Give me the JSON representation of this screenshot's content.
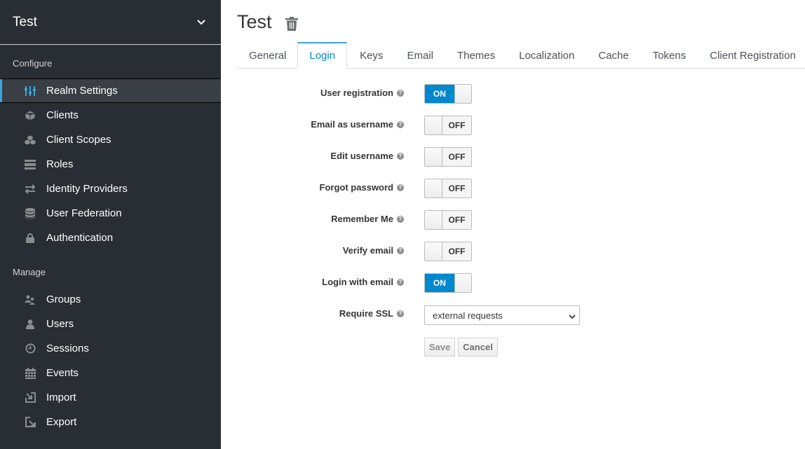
{
  "sidebar": {
    "realm_name": "Test",
    "configure_label": "Configure",
    "manage_label": "Manage",
    "configure_items": [
      {
        "label": "Realm Settings",
        "icon": "sliders-icon",
        "active": true
      },
      {
        "label": "Clients",
        "icon": "cube-icon"
      },
      {
        "label": "Client Scopes",
        "icon": "cubes-icon"
      },
      {
        "label": "Roles",
        "icon": "list-icon"
      },
      {
        "label": "Identity Providers",
        "icon": "exchange-icon"
      },
      {
        "label": "User Federation",
        "icon": "database-icon"
      },
      {
        "label": "Authentication",
        "icon": "lock-icon"
      }
    ],
    "manage_items": [
      {
        "label": "Groups",
        "icon": "users-icon"
      },
      {
        "label": "Users",
        "icon": "user-icon"
      },
      {
        "label": "Sessions",
        "icon": "clock-icon"
      },
      {
        "label": "Events",
        "icon": "calendar-icon"
      },
      {
        "label": "Import",
        "icon": "import-icon"
      },
      {
        "label": "Export",
        "icon": "export-icon"
      }
    ]
  },
  "header": {
    "title": "Test",
    "delete_icon": "trash-icon"
  },
  "tabs": [
    {
      "label": "General"
    },
    {
      "label": "Login",
      "active": true
    },
    {
      "label": "Keys"
    },
    {
      "label": "Email"
    },
    {
      "label": "Themes"
    },
    {
      "label": "Localization"
    },
    {
      "label": "Cache"
    },
    {
      "label": "Tokens"
    },
    {
      "label": "Client Registration"
    }
  ],
  "form": {
    "fields": [
      {
        "label": "User registration",
        "type": "toggle",
        "value": "ON"
      },
      {
        "label": "Email as username",
        "type": "toggle",
        "value": "OFF"
      },
      {
        "label": "Edit username",
        "type": "toggle",
        "value": "OFF"
      },
      {
        "label": "Forgot password",
        "type": "toggle",
        "value": "OFF"
      },
      {
        "label": "Remember Me",
        "type": "toggle",
        "value": "OFF"
      },
      {
        "label": "Verify email",
        "type": "toggle",
        "value": "OFF"
      },
      {
        "label": "Login with email",
        "type": "toggle",
        "value": "ON"
      },
      {
        "label": "Require SSL",
        "type": "select",
        "value": "external requests"
      }
    ],
    "help_glyph": "?",
    "save_label": "Save",
    "cancel_label": "Cancel"
  },
  "colors": {
    "sidebar_bg": "#292e34",
    "accent": "#0088ce",
    "active_indicator": "#39a5dc"
  }
}
